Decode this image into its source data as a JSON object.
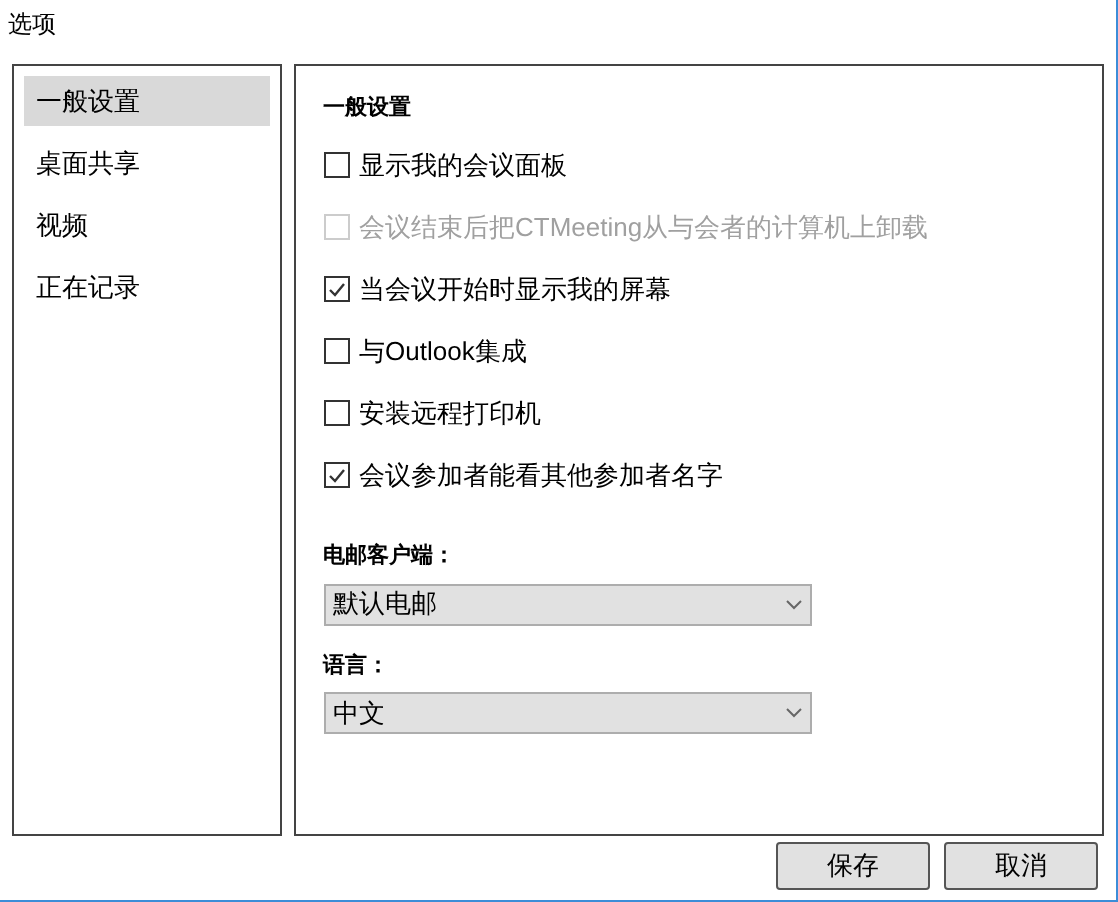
{
  "window": {
    "title": "选项"
  },
  "sidebar": {
    "items": [
      {
        "label": "一般设置",
        "selected": true
      },
      {
        "label": "桌面共享",
        "selected": false
      },
      {
        "label": "视频",
        "selected": false
      },
      {
        "label": "正在记录",
        "selected": false
      }
    ]
  },
  "section": {
    "heading": "一般设置",
    "options": [
      {
        "label": "显示我的会议面板",
        "checked": false,
        "disabled": false
      },
      {
        "label": "会议结束后把CTMeeting从与会者的计算机上卸载",
        "checked": false,
        "disabled": true
      },
      {
        "label": "当会议开始时显示我的屏幕",
        "checked": true,
        "disabled": false
      },
      {
        "label": "与Outlook集成",
        "checked": false,
        "disabled": false
      },
      {
        "label": "安装远程打印机",
        "checked": false,
        "disabled": false
      },
      {
        "label": "会议参加者能看其他参加者名字",
        "checked": true,
        "disabled": false
      }
    ],
    "selects": [
      {
        "label": "电邮客户端：",
        "value": "默认电邮"
      },
      {
        "label": "语言：",
        "value": "中文"
      }
    ]
  },
  "buttons": [
    "保存",
    "取消"
  ]
}
